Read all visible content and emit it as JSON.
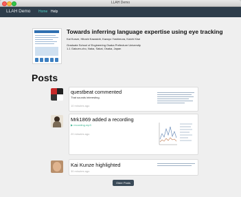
{
  "window": {
    "title": "LLAH Demo"
  },
  "nav": {
    "brand": "LLAH Demo",
    "items": [
      {
        "label": "Home"
      },
      {
        "label": "Help"
      }
    ]
  },
  "paper": {
    "title": "Towards inferring language expertise using eye tracking",
    "authors": "Kai Kunze, Hitoshi Kawaichi, Kazuyo Yoshimura, Koichi Kise",
    "affiliation_line1": "Graduate School of Engineering Osaka Prefecture University",
    "affiliation_line2": "1-1 Gakuen-cho, Naka, Sakai, Osaka, Japan"
  },
  "posts_heading": "Posts",
  "posts": [
    {
      "title": "questbeat commented",
      "detail": "That sounds interesting.",
      "time": "10 minutes ago"
    },
    {
      "title": "Mrk1869 added a recording",
      "link": "recording.mp3",
      "time": "20 minutes ago"
    },
    {
      "title": "Kai Kunze highlighted",
      "time": "30 minutes ago"
    }
  ],
  "older_button": "Older Posts",
  "colors": {
    "navbar": "#2e3d4b",
    "active_nav": "#4fd1c5",
    "link": "#3bb38f",
    "button": "#3a4a58"
  }
}
